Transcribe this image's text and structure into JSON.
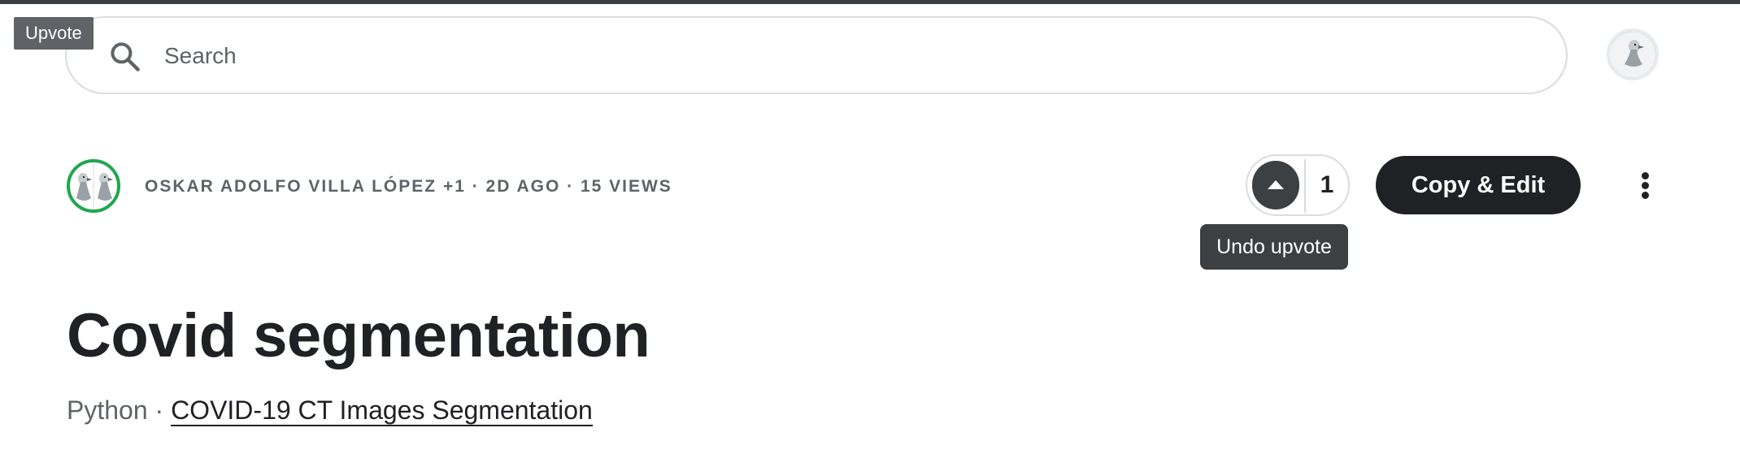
{
  "tooltips": {
    "upvote_hint": "Upvote",
    "undo_upvote": "Undo upvote"
  },
  "search": {
    "placeholder": "Search",
    "value": ""
  },
  "notebook": {
    "meta": "OSKAR ADOLFO VILLA LÓPEZ +1 · 2D AGO · 15 VIEWS",
    "upvote_count": "1",
    "copy_edit_label": "Copy & Edit",
    "title": "Covid segmentation",
    "language": "Python",
    "separator": "·",
    "dataset_link": "COVID-19 CT Images Segmentation"
  },
  "colors": {
    "accent_green": "#20a64f",
    "dark_button": "#202124",
    "tooltip_bg": "#3c4043"
  },
  "icons": {
    "search": "search-icon",
    "more": "more-vertical-icon",
    "upvote": "upvote-triangle-icon"
  }
}
